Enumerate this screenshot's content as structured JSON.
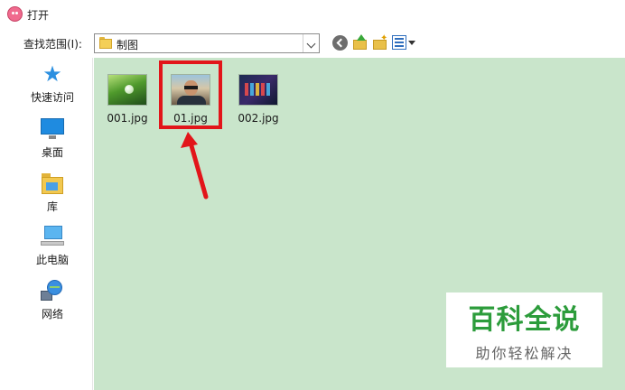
{
  "window": {
    "title": "打开"
  },
  "toolbar": {
    "lookin_label": "查找范围(I):",
    "lookin_value": "制图"
  },
  "places": [
    {
      "label": "快速访问",
      "icon": "quick-access-star-icon"
    },
    {
      "label": "桌面",
      "icon": "desktop-icon"
    },
    {
      "label": "库",
      "icon": "library-icon"
    },
    {
      "label": "此电脑",
      "icon": "this-pc-icon"
    },
    {
      "label": "网络",
      "icon": "network-icon"
    }
  ],
  "files": [
    {
      "name": "001.jpg"
    },
    {
      "name": "01.jpg",
      "highlighted": true
    },
    {
      "name": "002.jpg"
    }
  ],
  "watermark": {
    "main": "百科全说",
    "sub": "助你轻松解决"
  },
  "colors": {
    "file_area_bg": "#c9e5cb",
    "highlight": "#e2151a",
    "watermark_green": "#2c9c3b"
  }
}
